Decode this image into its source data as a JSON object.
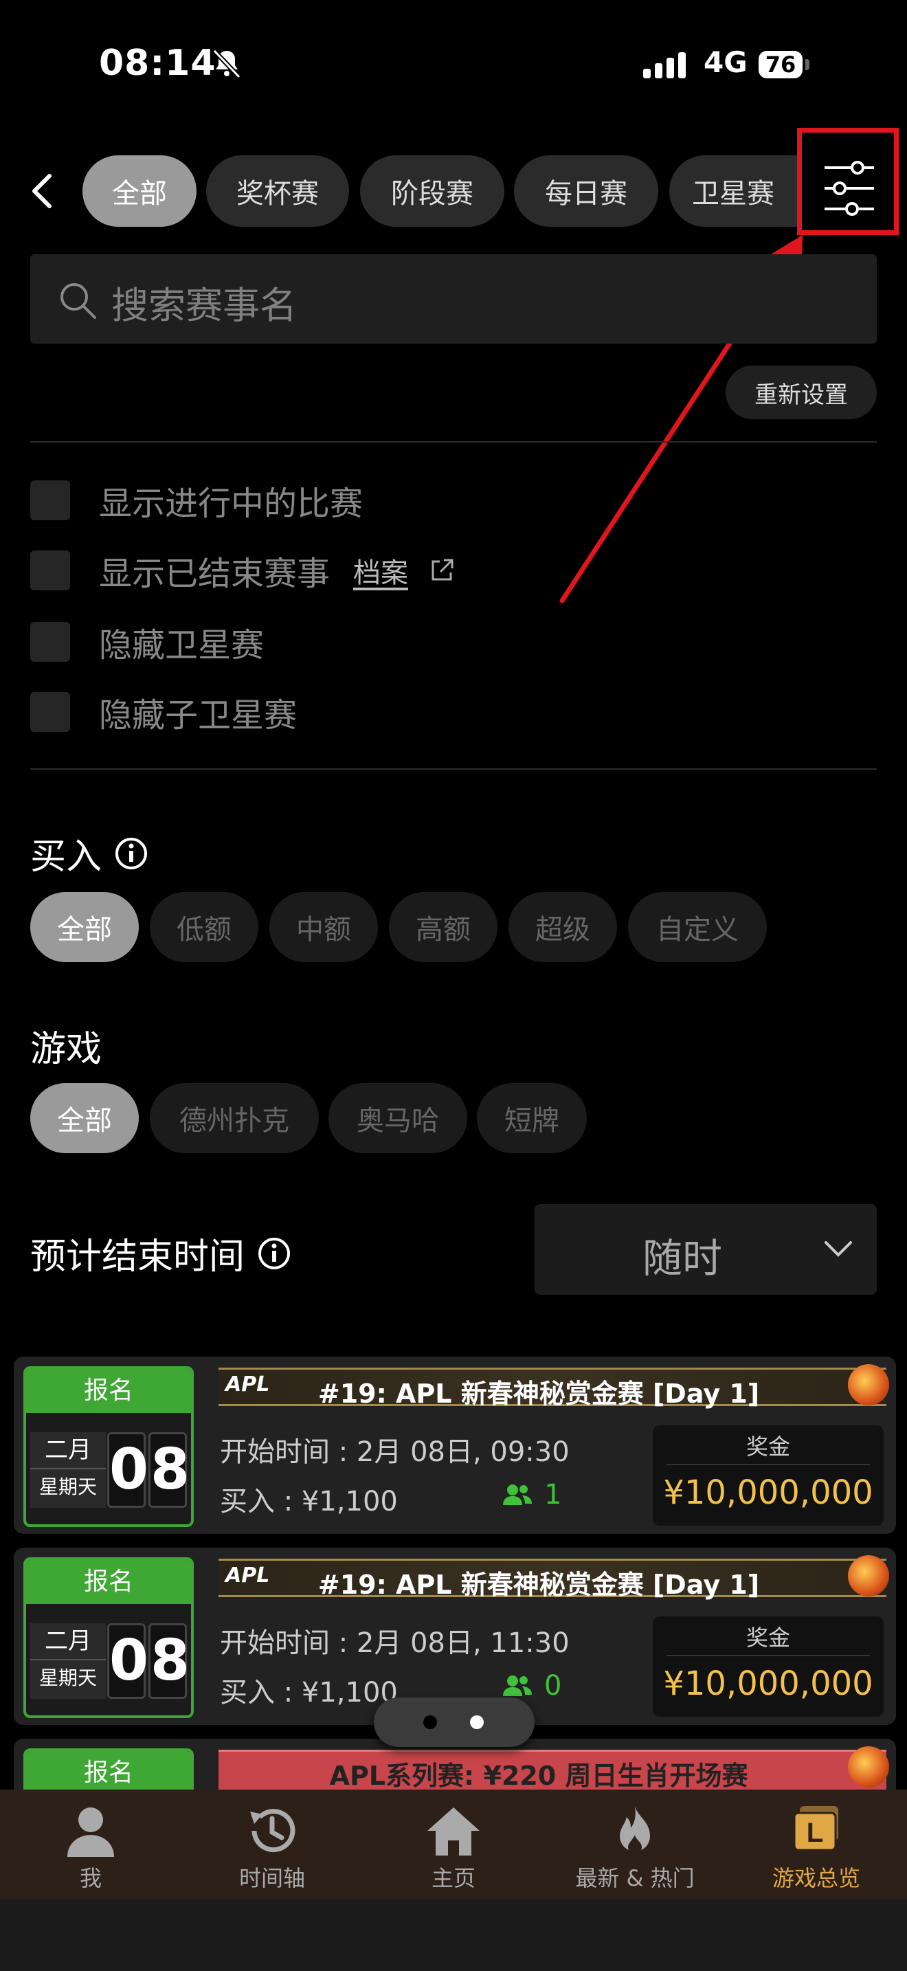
{
  "status": {
    "time": "08:14",
    "network": "4G",
    "battery": "76"
  },
  "tabs": [
    {
      "label": "全部",
      "active": true
    },
    {
      "label": "奖杯赛"
    },
    {
      "label": "阶段赛"
    },
    {
      "label": "每日赛"
    },
    {
      "label": "卫星赛"
    }
  ],
  "search": {
    "placeholder": "搜索赛事名"
  },
  "reset_label": "重新设置",
  "checkboxes": [
    {
      "label": "显示进行中的比赛",
      "checked": false
    },
    {
      "label": "显示已结束赛事",
      "checked": false,
      "link": "档案"
    },
    {
      "label": "隐藏卫星赛",
      "checked": false
    },
    {
      "label": "隐藏子卫星赛",
      "checked": false
    }
  ],
  "buyin": {
    "title": "买入",
    "options": [
      "全部",
      "低额",
      "中额",
      "高额",
      "超级",
      "自定义"
    ],
    "selected": "全部"
  },
  "game": {
    "title": "游戏",
    "options": [
      "全部",
      "德州扑克",
      "奥马哈",
      "短牌"
    ],
    "selected": "全部"
  },
  "end_time": {
    "title": "预计结束时间",
    "value": "随时"
  },
  "tournaments": [
    {
      "status": "报名",
      "month": "二月",
      "weekday": "星期天",
      "day_digits": [
        "0",
        "8"
      ],
      "logo": "APL",
      "title": "#19: APL 新春神秘赏金赛 [Day 1]",
      "start": "开始时间 : 2月 08日, 09:30",
      "buyin": "买入 : ¥1,100",
      "players": "1",
      "prize_label": "奖金",
      "prize": "¥10,000,000"
    },
    {
      "status": "报名",
      "month": "二月",
      "weekday": "星期天",
      "day_digits": [
        "0",
        "8"
      ],
      "logo": "APL",
      "title": "#19: APL 新春神秘赏金赛 [Day 1]",
      "start": "开始时间 : 2月 08日, 11:30",
      "buyin": "买入 : ¥1,100",
      "players": "0",
      "prize_label": "奖金",
      "prize": "¥10,000,000"
    },
    {
      "status": "报名",
      "title": "APL系列赛: ¥220 周日生肖开场赛"
    }
  ],
  "nav": [
    {
      "label": "我",
      "icon": "person-icon"
    },
    {
      "label": "时间轴",
      "icon": "history-icon"
    },
    {
      "label": "主页",
      "icon": "home-icon"
    },
    {
      "label": "最新 & 热门",
      "icon": "fire-icon"
    },
    {
      "label": "游戏总览",
      "icon": "lobby-icon",
      "active": true
    }
  ],
  "colors": {
    "accent_green": "#3fa835",
    "prize_gold": "#f4c24a",
    "highlight_red": "#e1151c",
    "nav_active": "#e0a845"
  }
}
